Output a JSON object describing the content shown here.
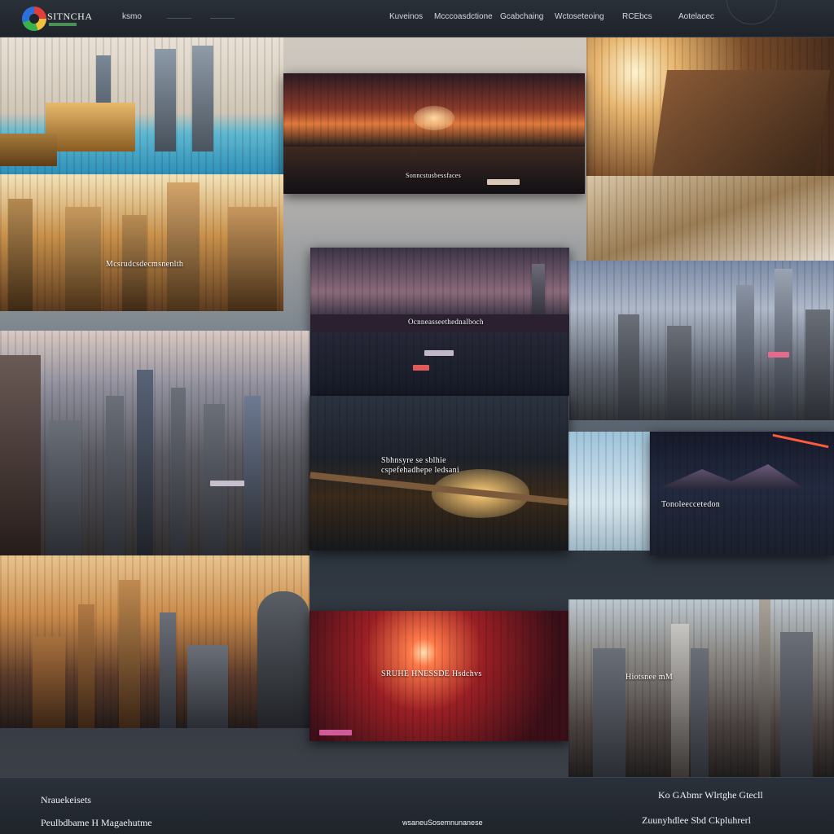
{
  "header": {
    "brand": "SITNCHA",
    "nav": [
      "ksmo",
      "Kuveinos",
      "Mcccoasdctione",
      "Gcabchaing",
      "Wctoseteoing",
      "RCEbcs",
      "Aotelacec"
    ]
  },
  "gallery": {
    "cards": [
      {
        "id": "sunset-harbor",
        "title": "Sonncstusbessfaces"
      },
      {
        "id": "golden-skyline",
        "title": "Mcsrudcsdecmsnenlth"
      },
      {
        "id": "river-night",
        "title": "Ocnneasseethednalboch"
      },
      {
        "id": "glow-bridge",
        "title": "Sbhnsyre se sblhie"
      },
      {
        "id": "glow-bridge-sub",
        "title": "cspefehadhepe ledsani"
      },
      {
        "id": "mountain-dusk",
        "title": "Tonoleeccetedon"
      },
      {
        "id": "red-sun",
        "title": "SRUHE HNESSDE Hsdchvs"
      },
      {
        "id": "metro-dense",
        "title": "Hiotsnee mM"
      }
    ]
  },
  "footer": {
    "heading": "Nrauekeisets",
    "subline": "Peulbdbame H Magaehutme",
    "center_link": "wsaneuSosemnunanese",
    "right_line1": "Ko GAbmr Wlrtghe Gtecll",
    "right_line2": "Zuunyhdlee Sbd Ckpluhrerl"
  },
  "colors": {
    "accent_logo": [
      "#e23c3c",
      "#f2c13b",
      "#37b34a",
      "#2d6fd8"
    ],
    "bar": "#1e232a",
    "highlight": "#ff5a3a"
  }
}
